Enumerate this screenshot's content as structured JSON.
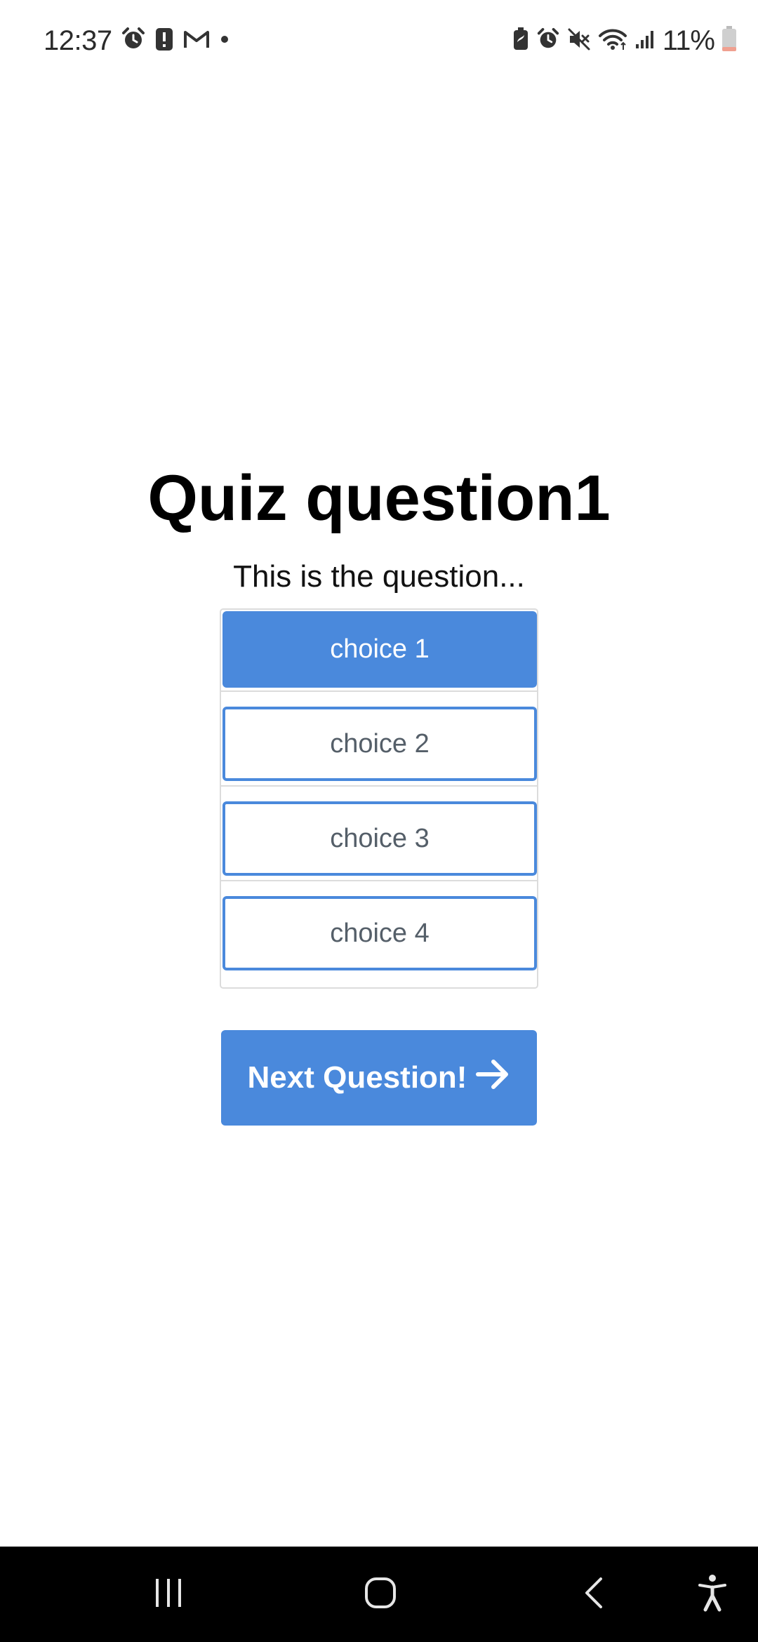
{
  "status_bar": {
    "time": "12:37",
    "battery_percent": "11%",
    "left_icons": [
      "alarm-icon",
      "alert-icon",
      "gmail-icon",
      "dot-icon"
    ],
    "right_icons": [
      "battery-saver-icon",
      "alarm-icon",
      "mute-icon",
      "wifi-icon",
      "signal-icon",
      "battery-icon"
    ]
  },
  "quiz": {
    "title": "Quiz question1",
    "question": "This is the question...",
    "choices": [
      {
        "label": "choice 1",
        "selected": true
      },
      {
        "label": "choice 2",
        "selected": false
      },
      {
        "label": "choice 3",
        "selected": false
      },
      {
        "label": "choice 4",
        "selected": false
      }
    ],
    "next_label": "Next Question!",
    "next_icon": "arrow-right-icon"
  },
  "nav_bar": {
    "buttons": [
      "recents-icon",
      "home-icon",
      "back-icon",
      "accessibility-icon"
    ]
  },
  "colors": {
    "accent": "#4a89dc",
    "outline_text": "#555f69",
    "nav_background": "#000000",
    "battery_low": "#f0a090"
  }
}
